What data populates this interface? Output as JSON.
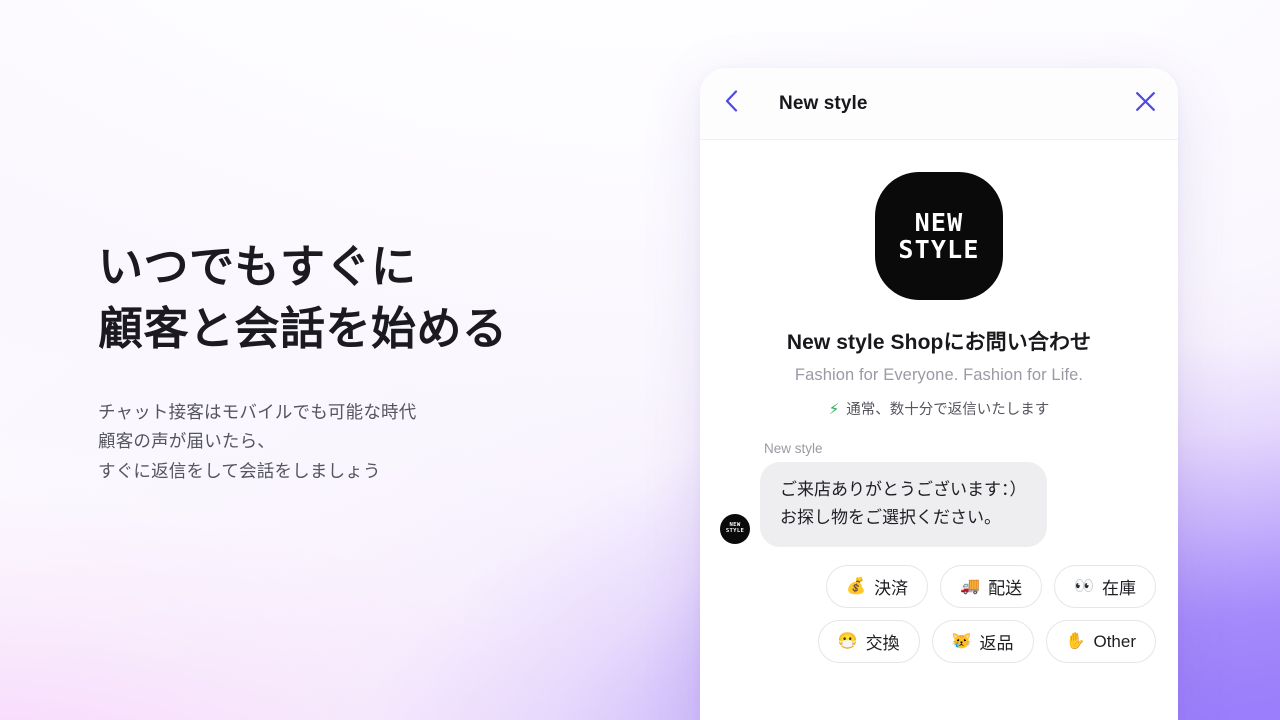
{
  "hero": {
    "headline": "いつでもすぐに\n顧客と会話を始める",
    "subcopy": "チャット接客はモバイルでも可能な時代\n顧客の声が届いたら、\nすぐに返信をして会話をしましょう"
  },
  "chat_widget": {
    "header": {
      "title": "New style",
      "back_icon": "chevron-left-icon",
      "close_icon": "close-icon",
      "accent_color": "#4d48e8"
    },
    "brand": {
      "logo_line1": "NEW",
      "logo_line2": "STYLE",
      "logo_bg": "#0a0a0a",
      "shop_title": "New style Shopにお問い合わせ",
      "tagline": "Fashion for Everyone. Fashion for Life.",
      "reply_time": "通常、数十分で返信いたします",
      "reply_time_icon": "⚡",
      "reply_time_icon_color": "#27ae52"
    },
    "message": {
      "sender": "New style",
      "text": "ご来店ありがとうございます：）\nお探し物をご選択ください。",
      "avatar_line1": "NEW",
      "avatar_line2": "STYLE",
      "bubble_color": "#eeeef0"
    },
    "quick_replies": [
      {
        "emoji": "💰",
        "label": "決済",
        "icon_name": "money-bag-icon"
      },
      {
        "emoji": "🚚",
        "label": "配送",
        "icon_name": "delivery-truck-icon"
      },
      {
        "emoji": "👀",
        "label": "在庫",
        "icon_name": "eyes-icon"
      },
      {
        "emoji": "😷",
        "label": "交換",
        "icon_name": "mask-face-icon"
      },
      {
        "emoji": "😿",
        "label": "返品",
        "icon_name": "crying-cat-icon"
      },
      {
        "emoji": "✋",
        "label": "Other",
        "icon_name": "raised-hand-icon"
      }
    ]
  }
}
